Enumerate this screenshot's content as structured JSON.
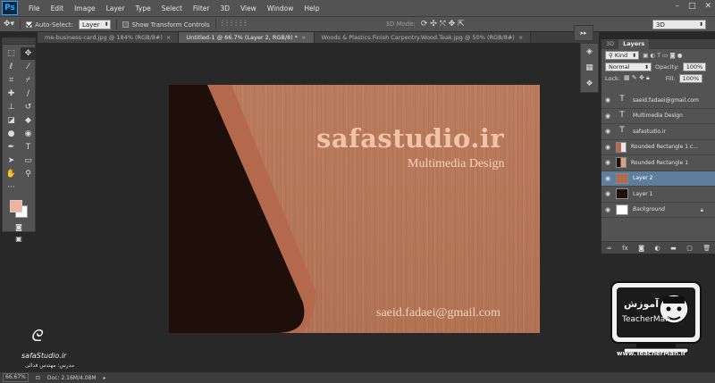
{
  "app": {
    "logo": "Ps"
  },
  "menu": [
    "File",
    "Edit",
    "Image",
    "Layer",
    "Type",
    "Select",
    "Filter",
    "3D",
    "View",
    "Window",
    "Help"
  ],
  "window_controls": [
    "–",
    "□",
    "✕"
  ],
  "options": {
    "auto_select_label": "Auto-Select:",
    "auto_select_checked": true,
    "auto_select_target": "Layer",
    "transform_label": "Show Transform Controls",
    "transform_checked": false,
    "mode_3d_label": "3D Mode:",
    "workspace": "3D"
  },
  "tabs": [
    {
      "label": "me-business-card.jpg @ 184% (RGB/8#)",
      "active": false
    },
    {
      "label": "Untitled-1 @ 66.7% (Layer 2, RGB/8) *",
      "active": true
    },
    {
      "label": "Woods & Plastics.Finish Carpentry.Wood.Teak.jpg @ 50% (RGB/8#)",
      "active": false
    }
  ],
  "colors": {
    "foreground": "#f1b29b",
    "background": "#ffffff",
    "selected_layer": "#5f7e9e",
    "card_dark": "#1f0f0b",
    "card_accent": "#b5694c"
  },
  "document": {
    "title": "safastudio.ir",
    "subtitle": "Multimedia Design",
    "email": "saeid.fadaei@gmail.com"
  },
  "layers_panel": {
    "tabs": [
      "3D",
      "Layers"
    ],
    "filter": "Kind",
    "blend_mode": "Normal",
    "opacity_label": "Opacity:",
    "opacity": "100%",
    "lock_label": "Lock:",
    "fill_label": "Fill:",
    "fill": "100%",
    "layers": [
      {
        "name": "saeid.fadaei@gmail.com",
        "kind": "text",
        "selected": false
      },
      {
        "name": "Multimedia Design",
        "kind": "text",
        "selected": false
      },
      {
        "name": "safastudio.ir",
        "kind": "text",
        "selected": false
      },
      {
        "name": "Rounded Rectangle 1 c...",
        "kind": "shape",
        "selected": false
      },
      {
        "name": "Rounded Rectangle 1",
        "kind": "shape",
        "selected": false
      },
      {
        "name": "Layer 2",
        "kind": "pixel",
        "selected": true
      },
      {
        "name": "Layer 1",
        "kind": "pixel",
        "selected": false
      },
      {
        "name": "Background",
        "kind": "background",
        "selected": false
      }
    ]
  },
  "status": {
    "zoom": "66.67%",
    "doc": "Doc: 2.16M/4.08M"
  },
  "watermarks": {
    "left_name": "safaStudio.ir",
    "left_sub": "مدرس: مهندس فدائی",
    "right_url": "www.TeacherMan.ir"
  }
}
